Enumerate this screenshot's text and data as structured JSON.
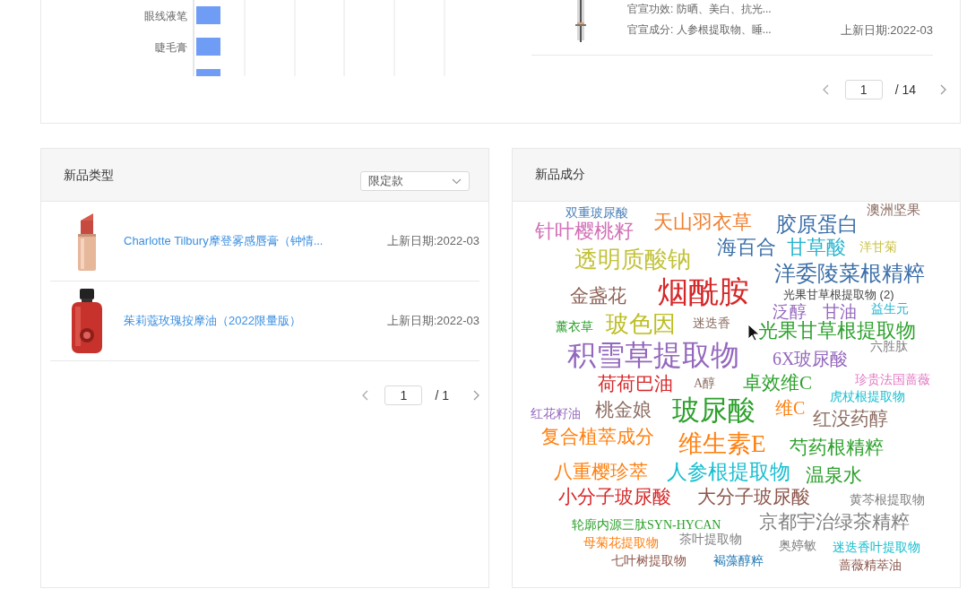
{
  "top_chart": {
    "labels": [
      "眼线液笔",
      "睫毛膏"
    ]
  },
  "top_product": {
    "kind": "picture",
    "efficacy": "官宣功效: 防晒、美白、抗光...",
    "ingredients": "官宣成分: 人参根提取物、睡...",
    "date": "上新日期:2022-03"
  },
  "top_pager": {
    "page": "1",
    "total": "/ 14"
  },
  "new_types": {
    "title": "新品类型",
    "filter": "限定款",
    "items": [
      {
        "kind": "picture",
        "name": "Charlotte Tilbury摩登雾感唇膏（钟情...",
        "date": "上新日期:2022-03"
      },
      {
        "kind": "picture",
        "name": "茱莉蔻玫瑰按摩油（2022限量版）",
        "date": "上新日期:2022-03"
      }
    ],
    "pager": {
      "page": "1",
      "total": "/ 1"
    }
  },
  "new_ingredients": {
    "title": "新品成分",
    "tooltip": "光果甘草根提取物 (2)",
    "words": [
      {
        "text": "双重玻尿酸",
        "color": "#4a7fb8"
      },
      {
        "text": "澳洲坚果",
        "color": "#8c6d62"
      },
      {
        "text": "针叶樱桃籽",
        "color": "#d16fb6"
      },
      {
        "text": "天山羽衣草",
        "color": "#f08030"
      },
      {
        "text": "胶原蛋白",
        "color": "#3a6ea8"
      },
      {
        "text": "海百合",
        "color": "#3a6ea8"
      },
      {
        "text": "甘草酸",
        "color": "#26b5cf"
      },
      {
        "text": "洋甘菊",
        "color": "#c9c24a"
      },
      {
        "text": "透明质酸钠",
        "color": "#c2c23a"
      },
      {
        "text": "洋委陵菜根精粹",
        "color": "#3a6ea8"
      },
      {
        "text": "金盏花",
        "color": "#8c5f52"
      },
      {
        "text": "烟酰胺",
        "color": "#d62728"
      },
      {
        "text": "泛醇",
        "color": "#9467bd"
      },
      {
        "text": "甘油",
        "color": "#9467bd"
      },
      {
        "text": "益生元",
        "color": "#26b5cf"
      },
      {
        "text": "薰衣草",
        "color": "#2ca02c"
      },
      {
        "text": "玻色因",
        "color": "#bcbd22"
      },
      {
        "text": "迷迭香",
        "color": "#8c6d62"
      },
      {
        "text": "光果甘草根提取物",
        "color": "#2ca02c"
      },
      {
        "text": "积雪草提取物",
        "color": "#9467bd"
      },
      {
        "text": "6X玻尿酸",
        "color": "#9467bd"
      },
      {
        "text": "六胜肽",
        "color": "#7f7f7f"
      },
      {
        "text": "荷荷巴油",
        "color": "#d62728"
      },
      {
        "text": "A醇",
        "color": "#8c6d62"
      },
      {
        "text": "卓效维C",
        "color": "#2ca02c"
      },
      {
        "text": "珍贵法国蔷薇",
        "color": "#e377c2"
      },
      {
        "text": "虎杖根提取物",
        "color": "#17becf"
      },
      {
        "text": "红花籽油",
        "color": "#9467bd"
      },
      {
        "text": "桃金娘",
        "color": "#8c6d62"
      },
      {
        "text": "玻尿酸",
        "color": "#2ca02c"
      },
      {
        "text": "维C",
        "color": "#ff7f0e"
      },
      {
        "text": "红没药醇",
        "color": "#8c6d62"
      },
      {
        "text": "复合植萃成分",
        "color": "#ff7f0e"
      },
      {
        "text": "维生素E",
        "color": "#ff7f0e"
      },
      {
        "text": "芍药根精粹",
        "color": "#2ca02c"
      },
      {
        "text": "八重樱珍萃",
        "color": "#ff7f0e"
      },
      {
        "text": "人参根提取物",
        "color": "#17becf"
      },
      {
        "text": "温泉水",
        "color": "#2ca02c"
      },
      {
        "text": "小分子玻尿酸",
        "color": "#d62728"
      },
      {
        "text": "大分子玻尿酸",
        "color": "#8c564b"
      },
      {
        "text": "黄芩根提取物",
        "color": "#7f7f7f"
      },
      {
        "text": "轮廓内源三肽SYN-HYCAN",
        "color": "#2ca02c"
      },
      {
        "text": "京都宇治绿茶精粹",
        "color": "#7f7f7f"
      },
      {
        "text": "母菊花提取物",
        "color": "#ff7f0e"
      },
      {
        "text": "茶叶提取物",
        "color": "#7f7f7f"
      },
      {
        "text": "奥婷敏",
        "color": "#7f7f7f"
      },
      {
        "text": "迷迭香叶提取物",
        "color": "#17becf"
      },
      {
        "text": "七叶树提取物",
        "color": "#8c564b"
      },
      {
        "text": "褐藻醇粹",
        "color": "#1f77b4"
      },
      {
        "text": "蔷薇精萃油",
        "color": "#8c564b"
      }
    ]
  }
}
